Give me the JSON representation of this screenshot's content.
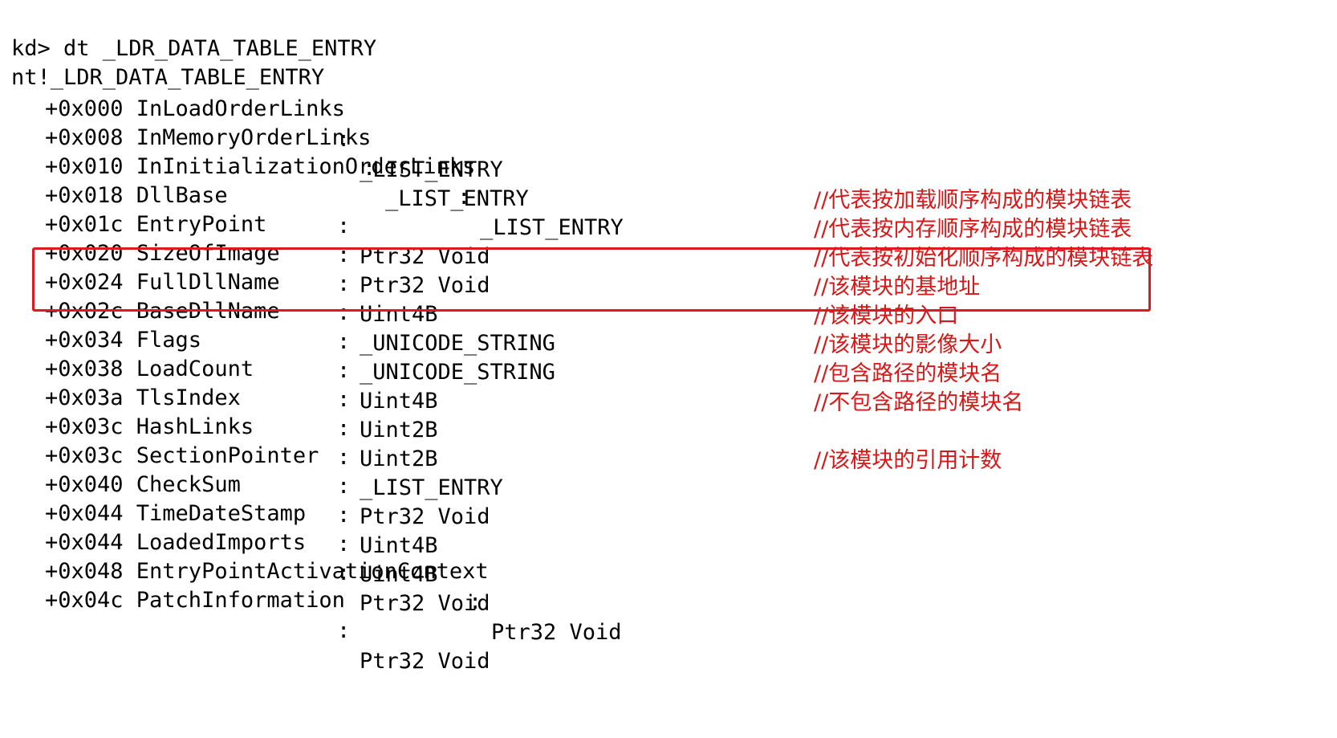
{
  "command_line": "kd> dt _LDR_DATA_TABLE_ENTRY",
  "struct_name": "nt!_LDR_DATA_TABLE_ENTRY",
  "fields": [
    {
      "entry": "+0x000 InLoadOrderLinks",
      "sep": ":",
      "type": "_LIST_ENTRY",
      "comment": "//代表按加载顺序构成的模块链表"
    },
    {
      "entry": "+0x008 InMemoryOrderLinks",
      "sep": ":",
      "type": "_LIST_ENTRY",
      "comment": "//代表按内存顺序构成的模块链表"
    },
    {
      "entry": "+0x010 InInitializationOrderLinks",
      "sep": ":",
      "type": "_LIST_ENTRY",
      "comment": "//代表按初始化顺序构成的模块链表"
    },
    {
      "entry": "+0x018 DllBase",
      "sep": ":",
      "type": "Ptr32 Void",
      "comment": "//该模块的基地址"
    },
    {
      "entry": "+0x01c EntryPoint",
      "sep": ":",
      "type": "Ptr32 Void",
      "comment": "//该模块的入口"
    },
    {
      "entry": "+0x020 SizeOfImage",
      "sep": ":",
      "type": "Uint4B",
      "comment": "//该模块的影像大小"
    },
    {
      "entry": "+0x024 FullDllName",
      "sep": ":",
      "type": "_UNICODE_STRING",
      "comment": "//包含路径的模块名"
    },
    {
      "entry": "+0x02c BaseDllName",
      "sep": ":",
      "type": "_UNICODE_STRING",
      "comment": "//不包含路径的模块名"
    },
    {
      "entry": "+0x034 Flags",
      "sep": ":",
      "type": "Uint4B",
      "comment": ""
    },
    {
      "entry": "+0x038 LoadCount",
      "sep": ":",
      "type": "Uint2B",
      "comment": "//该模块的引用计数"
    },
    {
      "entry": "+0x03a TlsIndex",
      "sep": ":",
      "type": "Uint2B",
      "comment": ""
    },
    {
      "entry": "+0x03c HashLinks",
      "sep": ":",
      "type": "_LIST_ENTRY",
      "comment": ""
    },
    {
      "entry": "+0x03c SectionPointer",
      "sep": ":",
      "type": "Ptr32 Void",
      "comment": ""
    },
    {
      "entry": "+0x040 CheckSum",
      "sep": ":",
      "type": "Uint4B",
      "comment": ""
    },
    {
      "entry": "+0x044 TimeDateStamp",
      "sep": ":",
      "type": "Uint4B",
      "comment": ""
    },
    {
      "entry": "+0x044 LoadedImports",
      "sep": ":",
      "type": "Ptr32 Void",
      "comment": ""
    },
    {
      "entry": "+0x048 EntryPointActivationContext",
      "sep": ":",
      "type": "Ptr32 Void",
      "comment": ""
    },
    {
      "entry": "+0x04c PatchInformation",
      "sep": ":",
      "type": "Ptr32 Void",
      "comment": ""
    }
  ],
  "colors": {
    "background": "#ffffff",
    "text": "#000000",
    "comment": "#d81818",
    "highlight_border": "#e0191f"
  }
}
